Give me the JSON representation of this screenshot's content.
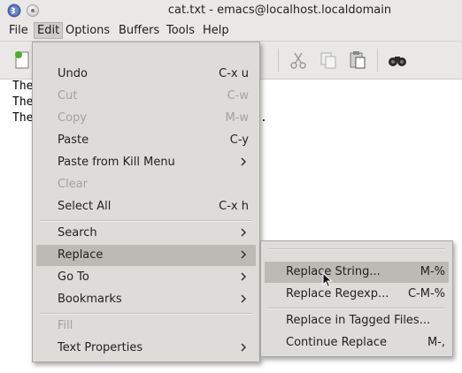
{
  "window": {
    "title": "cat.txt - emacs@localhost.localdomain"
  },
  "menubar": {
    "items": [
      "File",
      "Edit",
      "Options",
      "Buffers",
      "Tools",
      "Help"
    ]
  },
  "toolbar": {
    "icons": [
      "new-file-icon",
      "cut-icon",
      "copy-icon",
      "paste-icon",
      "search-binoculars-icon"
    ]
  },
  "editor": {
    "lines": [
      "The",
      "The",
      "The"
    ],
    "trailing_char": "."
  },
  "edit_menu": {
    "items": [
      {
        "label": "Undo",
        "shortcut": "C-x u",
        "disabled": false
      },
      {
        "label": "Cut",
        "shortcut": "C-w",
        "disabled": true
      },
      {
        "label": "Copy",
        "shortcut": "M-w",
        "disabled": true
      },
      {
        "label": "Paste",
        "shortcut": "C-y",
        "disabled": false
      },
      {
        "label": "Paste from Kill Menu",
        "submenu": true,
        "disabled": false
      },
      {
        "label": "Clear",
        "disabled": true
      },
      {
        "label": "Select All",
        "shortcut": "C-x h",
        "disabled": false
      },
      {
        "label": "Search",
        "submenu": true,
        "disabled": false
      },
      {
        "label": "Replace",
        "submenu": true,
        "disabled": false,
        "highlighted": true
      },
      {
        "label": "Go To",
        "submenu": true,
        "disabled": false
      },
      {
        "label": "Bookmarks",
        "submenu": true,
        "disabled": false
      },
      {
        "label": "Fill",
        "disabled": true
      },
      {
        "label": "Text Properties",
        "submenu": true,
        "disabled": false
      }
    ]
  },
  "replace_menu": {
    "items": [
      {
        "label": "Replace String...",
        "shortcut": "M-%",
        "highlighted": true
      },
      {
        "label": "Replace Regexp...",
        "shortcut": "C-M-%"
      },
      {
        "label": "Replace in Tagged Files..."
      },
      {
        "label": "Continue Replace",
        "shortcut": "M-,"
      }
    ]
  },
  "colors": {
    "menu_bg": "#dedcd9",
    "highlight": "#bdbab6",
    "disabled_text": "#a3a1a0"
  }
}
